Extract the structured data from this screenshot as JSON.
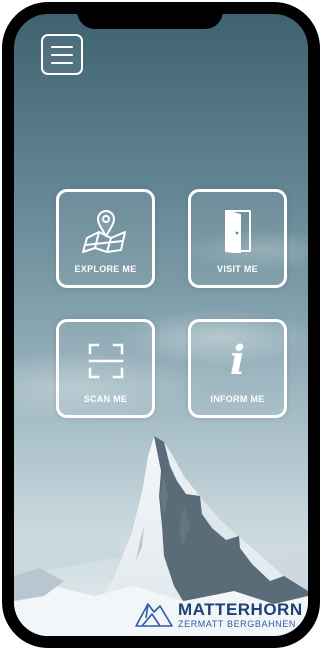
{
  "menu": {
    "icon": "hamburger-menu-icon"
  },
  "tiles": [
    {
      "label": "EXPLORE ME",
      "icon": "map-pin-icon"
    },
    {
      "label": "VISIT ME",
      "icon": "open-door-icon"
    },
    {
      "label": "SCAN ME",
      "icon": "scan-frame-icon"
    },
    {
      "label": "INFORM ME",
      "icon": "info-icon"
    }
  ],
  "info_glyph": "i",
  "brand": {
    "title": "MATTERHORN",
    "subtitle": "ZERMATT BERGBAHNEN",
    "title_color": "#1f3f78",
    "subtitle_color": "#2e5aa6"
  }
}
